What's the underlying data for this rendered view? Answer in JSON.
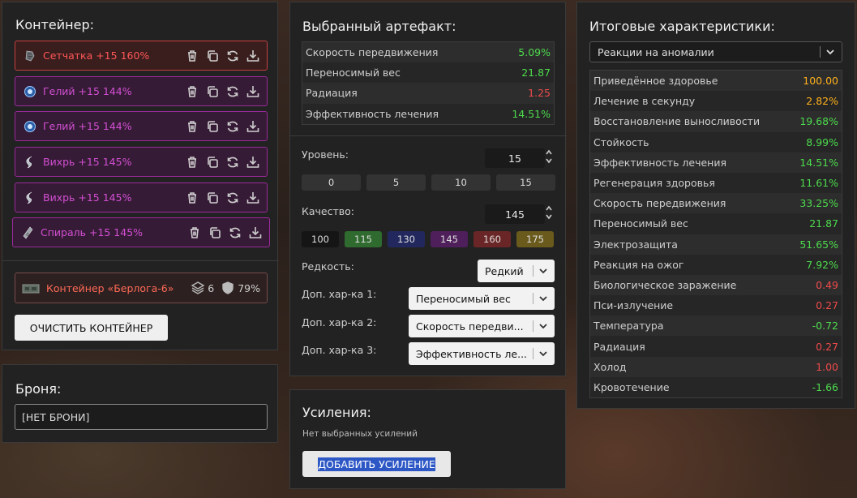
{
  "container": {
    "title": "Контейнер:",
    "artifacts": [
      {
        "label": "Сетчатка +15 160%",
        "style": "red",
        "icon": "mesh-artifact-icon"
      },
      {
        "label": "Гелий +15 144%",
        "style": "mag",
        "icon": "helium-artifact-icon"
      },
      {
        "label": "Гелий +15 144%",
        "style": "mag",
        "icon": "helium-artifact-icon"
      },
      {
        "label": "Вихрь +15 145%",
        "style": "mag",
        "icon": "vortex-artifact-icon"
      },
      {
        "label": "Вихрь +15 145%",
        "style": "mag",
        "icon": "vortex-artifact-icon"
      },
      {
        "label": "Спираль +15 145%",
        "style": "mag",
        "icon": "spiral-artifact-icon"
      }
    ],
    "box": {
      "label": "Контейнер «Берлога-6»",
      "slots": "6",
      "protection": "79%"
    },
    "clear_button": "ОЧИСТИТЬ КОНТЕЙНЕР"
  },
  "armor": {
    "title": "Броня:",
    "value": "[НЕТ БРОНИ]"
  },
  "selected": {
    "title": "Выбранный артефакт:",
    "stats": [
      {
        "name": "Скорость передвижения",
        "value": "5.09%",
        "color": "green"
      },
      {
        "name": "Переносимый вес",
        "value": "21.87",
        "color": "green"
      },
      {
        "name": "Радиация",
        "value": "1.25",
        "color": "red"
      },
      {
        "name": "Эффективность лечения",
        "value": "14.51%",
        "color": "green"
      }
    ],
    "level_label": "Уровень:",
    "level_value": "15",
    "level_presets": [
      "0",
      "5",
      "10",
      "15"
    ],
    "quality_label": "Качество:",
    "quality_value": "145",
    "quality_presets": [
      {
        "label": "100",
        "bg": "#151515"
      },
      {
        "label": "115",
        "bg": "#2f6a2f"
      },
      {
        "label": "130",
        "bg": "#22285e"
      },
      {
        "label": "145",
        "bg": "#4f1f5b"
      },
      {
        "label": "160",
        "bg": "#6a2626"
      },
      {
        "label": "175",
        "bg": "#6a5a1c"
      }
    ],
    "rarity_label": "Редкость:",
    "rarity_value": "Редкий",
    "extra1_label": "Доп. хар-ка 1:",
    "extra1_value": "Переносимый вес",
    "extra2_label": "Доп. хар-ка 2:",
    "extra2_value": "Скорость передви...",
    "extra3_label": "Доп. хар-ка 3:",
    "extra3_value": "Эффективность ле..."
  },
  "boosts": {
    "title": "Усиления:",
    "empty": "Нет выбранных усилений",
    "add_button": "ДОБАВИТЬ УСИЛЕНИЕ"
  },
  "totals": {
    "title": "Итоговые характеристики:",
    "filter": "Реакции на аномалии",
    "stats": [
      {
        "name": "Приведённое здоровье",
        "value": "100.00",
        "color": "orange"
      },
      {
        "name": "Лечение в секунду",
        "value": "2.82%",
        "color": "orange"
      },
      {
        "name": "Восстановление выносливости",
        "value": "19.68%",
        "color": "green"
      },
      {
        "name": "Стойкость",
        "value": "8.99%",
        "color": "green"
      },
      {
        "name": "Эффективность лечения",
        "value": "14.51%",
        "color": "green"
      },
      {
        "name": "Регенерация здоровья",
        "value": "11.61%",
        "color": "green"
      },
      {
        "name": "Скорость передвижения",
        "value": "33.25%",
        "color": "green"
      },
      {
        "name": "Переносимый вес",
        "value": "21.87",
        "color": "green"
      },
      {
        "name": "Электрозащита",
        "value": "51.65%",
        "color": "green"
      },
      {
        "name": "Реакция на ожог",
        "value": "7.92%",
        "color": "green"
      },
      {
        "name": "Биологическое заражение",
        "value": "0.49",
        "color": "red"
      },
      {
        "name": "Пси-излучение",
        "value": "0.27",
        "color": "red"
      },
      {
        "name": "Температура",
        "value": "-0.72",
        "color": "green"
      },
      {
        "name": "Радиация",
        "value": "0.27",
        "color": "red"
      },
      {
        "name": "Холод",
        "value": "1.00",
        "color": "red"
      },
      {
        "name": "Кровотечение",
        "value": "-1.66",
        "color": "green"
      }
    ]
  }
}
